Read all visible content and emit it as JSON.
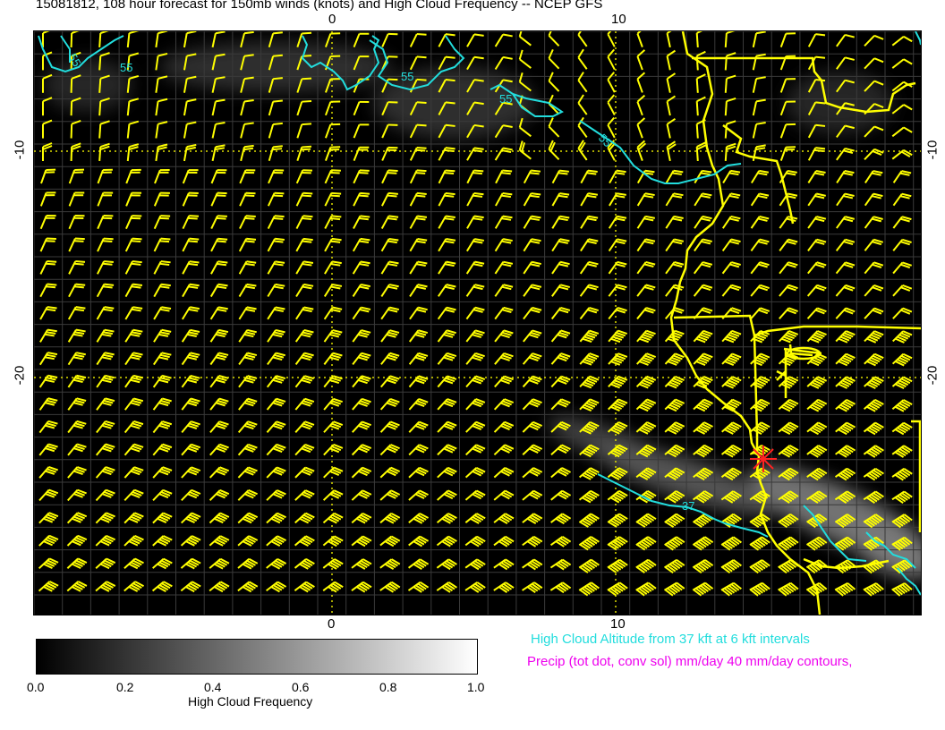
{
  "title": "15081812, 108 hour forecast for 150mb winds (knots) and High Cloud Frequency -- NCEP GFS",
  "top_axis": [
    "0",
    "10"
  ],
  "bottom_axis": [
    "0",
    "10"
  ],
  "left_axis": [
    "-10",
    "-20"
  ],
  "right_axis": [
    "-10",
    "-20"
  ],
  "contour_labels": [
    "55",
    "55",
    "55",
    "55",
    "55",
    "37"
  ],
  "legend": {
    "cloud_altitude": "High Cloud Altitude from 37 kft at 6 kft intervals",
    "precip": "Precip (tot dot, conv sol) mm/day 40 mm/day contours,",
    "cloud_altitude_color": "#22dddd",
    "precip_color": "#ee00ee"
  },
  "colorbar": {
    "title": "High Cloud Frequency",
    "ticks": [
      "0.0",
      "0.2",
      "0.4",
      "0.6",
      "0.8",
      "1.0"
    ]
  },
  "colors": {
    "barbs": "#ffff00",
    "coast": "#ffff00",
    "contours": "#22dddd",
    "marker": "#ff2222",
    "background": "#000000"
  }
}
